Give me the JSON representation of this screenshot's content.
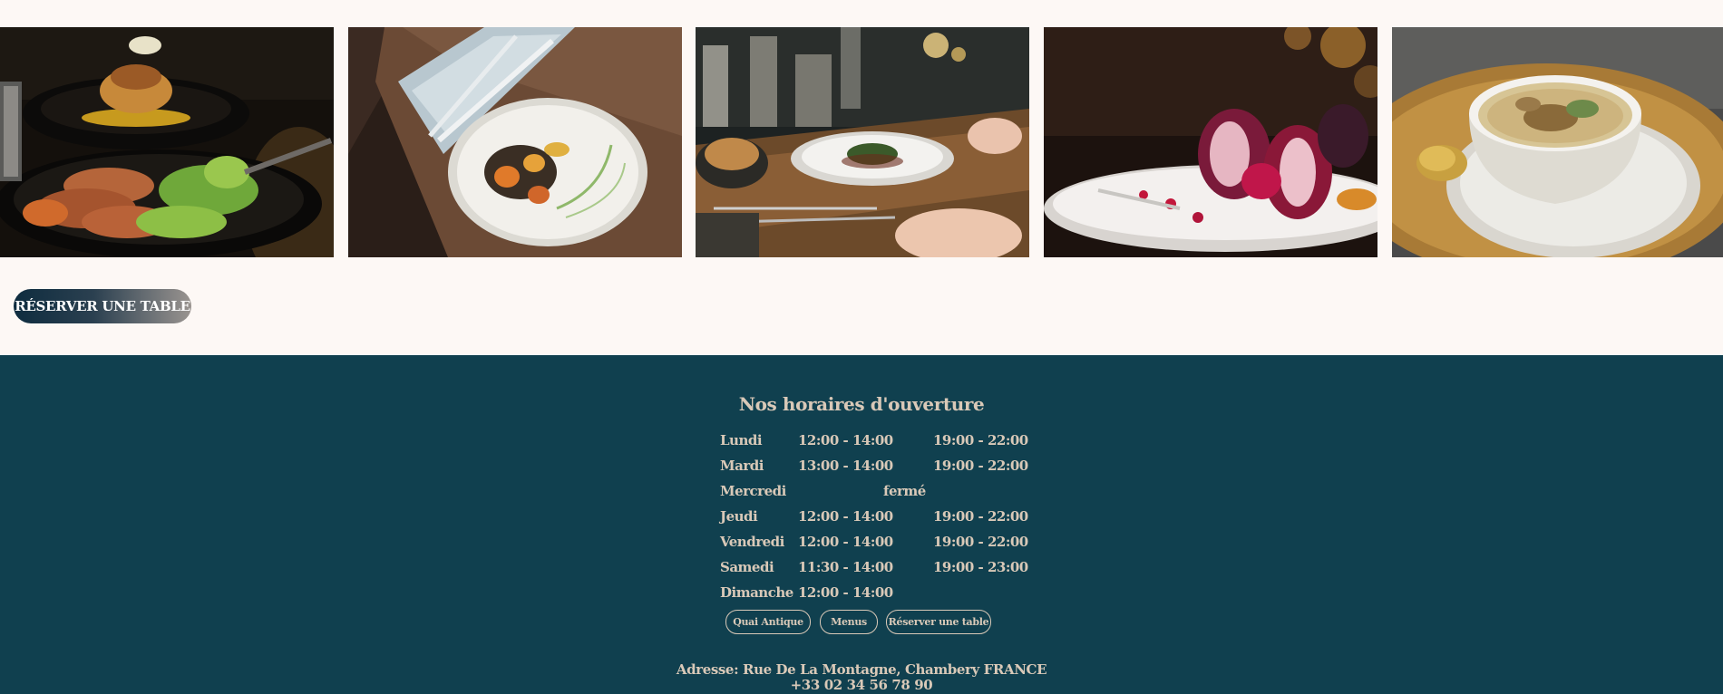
{
  "gallery": {
    "photos": [
      {
        "icon": "roast-platter-photo"
      },
      {
        "icon": "vegetable-plate-photo"
      },
      {
        "icon": "dining-table-photo"
      },
      {
        "icon": "fig-dessert-photo"
      },
      {
        "icon": "soup-bowl-photo"
      }
    ]
  },
  "cta": {
    "reserve_label": "RÉSERVER UNE TABLE"
  },
  "footer": {
    "title": "Nos horaires d'ouverture",
    "hours": [
      {
        "day": "Lundi",
        "lunch": "12:00 - 14:00",
        "dinner": "19:00 - 22:00"
      },
      {
        "day": "Mardi",
        "lunch": "13:00 - 14:00",
        "dinner": "19:00 - 22:00"
      },
      {
        "day": "Mercredi",
        "closed": "fermé"
      },
      {
        "day": "Jeudi",
        "lunch": "12:00 - 14:00",
        "dinner": "19:00 - 22:00"
      },
      {
        "day": "Vendredi",
        "lunch": "12:00 - 14:00",
        "dinner": "19:00 - 22:00"
      },
      {
        "day": "Samedi",
        "lunch": "11:30 - 14:00",
        "dinner": "19:00 - 23:00"
      },
      {
        "day": "Dimanche",
        "lunch": "12:00 - 14:00",
        "dinner": ""
      }
    ],
    "links": [
      "Quai Antique",
      "Menus",
      "Réserver une table"
    ],
    "address": "Adresse: Rue De La Montagne, Chambery FRANCE",
    "phone": "+33 02 34 56 78 90"
  },
  "colors": {
    "background": "#fdf8f5",
    "footer": "#10404f",
    "footer_text": "#d9c9b8",
    "button_start": "#0e2c3f",
    "button_end": "#9a9490"
  }
}
